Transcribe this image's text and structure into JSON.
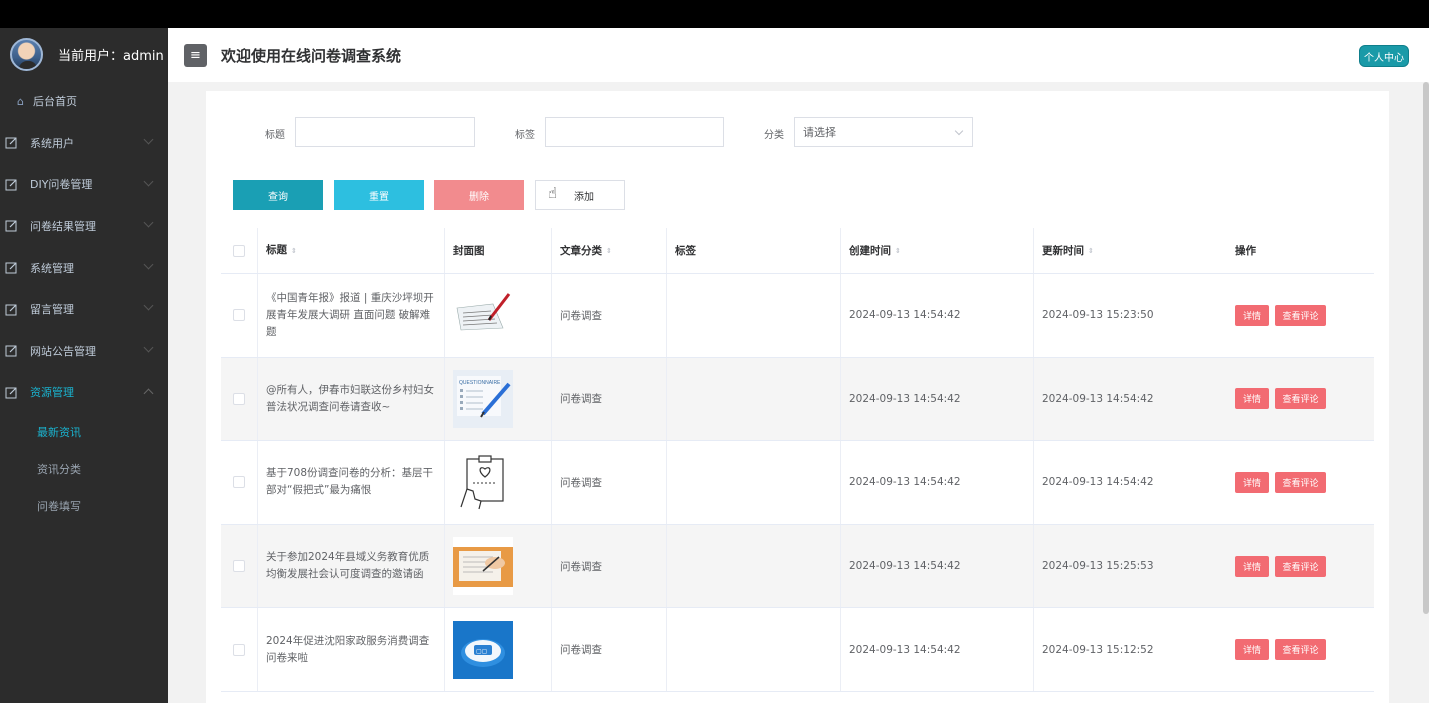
{
  "sidebar": {
    "user_text": "当前用户：admin",
    "home": "后台首页",
    "items": [
      {
        "label": "系统用户"
      },
      {
        "label": "DIY问卷管理"
      },
      {
        "label": "问卷结果管理"
      },
      {
        "label": "系统管理"
      },
      {
        "label": "留言管理"
      },
      {
        "label": "网站公告管理"
      },
      {
        "label": "资源管理"
      }
    ],
    "sub_items": [
      {
        "label": "最新资讯"
      },
      {
        "label": "资讯分类"
      },
      {
        "label": "问卷填写"
      }
    ]
  },
  "header": {
    "menu_icon": "≡",
    "title": "欢迎使用在线问卷调查系统",
    "personal_button": "个人中心"
  },
  "search": {
    "title_label": "标题",
    "tag_label": "标签",
    "category_label": "分类",
    "category_placeholder": "请选择"
  },
  "buttons": {
    "query": "查询",
    "reset": "重置",
    "delete": "删除",
    "add": "添加"
  },
  "table": {
    "columns": [
      "标题",
      "封面图",
      "文章分类",
      "标签",
      "创建时间",
      "更新时间",
      "操作"
    ],
    "rows": [
      {
        "title": "《中国青年报》报道 | 重庆沙坪坝开展青年发展大调研 直面问题 破解难题",
        "category": "问卷调查",
        "tag": "",
        "created": "2024-09-13 14:54:42",
        "updated": "2024-09-13 15:23:50"
      },
      {
        "title": "@所有人，伊春市妇联这份乡村妇女普法状况调查问卷请查收~",
        "category": "问卷调查",
        "tag": "",
        "created": "2024-09-13 14:54:42",
        "updated": "2024-09-13 14:54:42"
      },
      {
        "title": "基于708份调查问卷的分析：基层干部对“假把式”最为痛恨",
        "category": "问卷调查",
        "tag": "",
        "created": "2024-09-13 14:54:42",
        "updated": "2024-09-13 14:54:42"
      },
      {
        "title": "关于参加2024年县域义务教育优质均衡发展社会认可度调查的邀请函",
        "category": "问卷调查",
        "tag": "",
        "created": "2024-09-13 14:54:42",
        "updated": "2024-09-13 15:25:53"
      },
      {
        "title": "2024年促进沈阳家政服务消费调查问卷来啦",
        "category": "问卷调查",
        "tag": "",
        "created": "2024-09-13 14:54:42",
        "updated": "2024-09-13 15:12:52"
      }
    ],
    "op_detail": "详情",
    "op_comment": "查看评论",
    "sort_icon": "⇕"
  }
}
